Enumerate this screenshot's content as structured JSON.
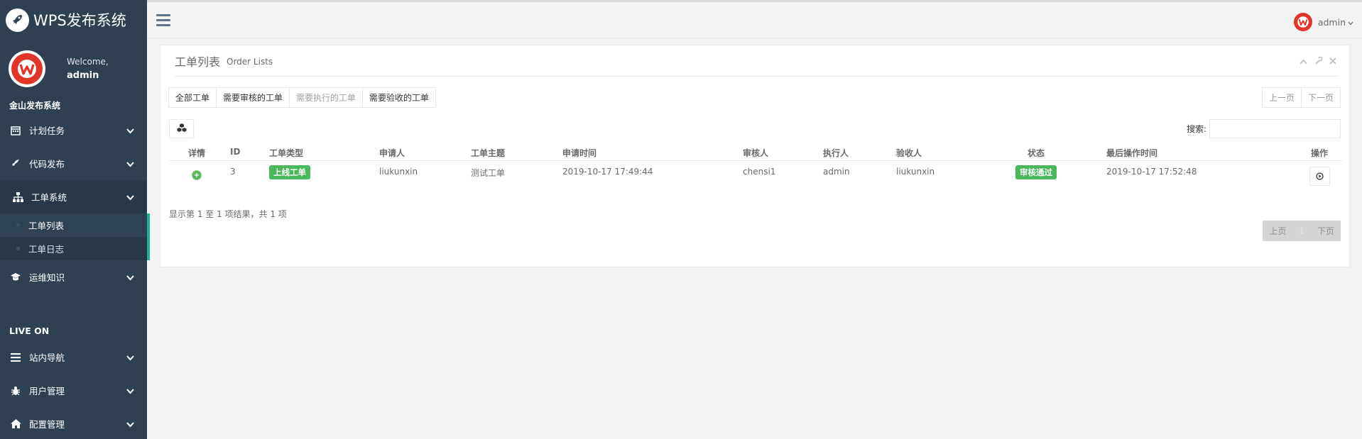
{
  "brand": {
    "title": "WPS发布系统",
    "logo_icon": "rocket-icon"
  },
  "profile": {
    "welcome": "Welcome,",
    "username": "admin"
  },
  "sidebar": {
    "section1": "金山发布系统",
    "items": [
      {
        "label": "计划任务",
        "icon": "calendar-icon"
      },
      {
        "label": "代码发布",
        "icon": "rocket-icon"
      },
      {
        "label": "工单系统",
        "icon": "sitemap-icon"
      },
      {
        "label": "运维知识",
        "icon": "graduation-cap-icon"
      }
    ],
    "sub_items": [
      {
        "label": "工单列表"
      },
      {
        "label": "工单日志"
      }
    ],
    "section2": "LIVE ON",
    "items2": [
      {
        "label": "站内导航",
        "icon": "list-icon"
      },
      {
        "label": "用户管理",
        "icon": "bug-icon"
      },
      {
        "label": "配置管理",
        "icon": "home-icon"
      }
    ]
  },
  "topbar": {
    "user": "admin"
  },
  "panel": {
    "title": "工单列表",
    "subtitle": "Order Lists",
    "filters": [
      "全部工单",
      "需要审核的工单",
      "需要执行的工单",
      "需要验收的工单"
    ],
    "pager_prev": "上一页",
    "pager_next": "下一页",
    "search_label": "搜索:",
    "search_value": "",
    "columns": [
      "详情",
      "ID",
      "工单类型",
      "申请人",
      "工单主题",
      "申请时间",
      "审核人",
      "执行人",
      "验收人",
      "状态",
      "最后操作时间",
      "操作"
    ],
    "rows": [
      {
        "id": "3",
        "type": "上线工单",
        "applicant": "liukunxin",
        "subject": "测试工单",
        "apply_time": "2019-10-17 17:49:44",
        "reviewer": "chensi1",
        "executor": "admin",
        "acceptor": "liukunxin",
        "status": "审核通过",
        "last_time": "2019-10-17 17:52:48"
      }
    ],
    "info": "显示第 1 至 1 项结果，共 1 项",
    "bottom_prev": "上页",
    "bottom_page": "1",
    "bottom_next": "下页"
  },
  "colors": {
    "sidebar_bg": "#2f4050",
    "accent": "#1ab394",
    "badge_green": "#49b85a",
    "logo_red": "#e2352a"
  }
}
